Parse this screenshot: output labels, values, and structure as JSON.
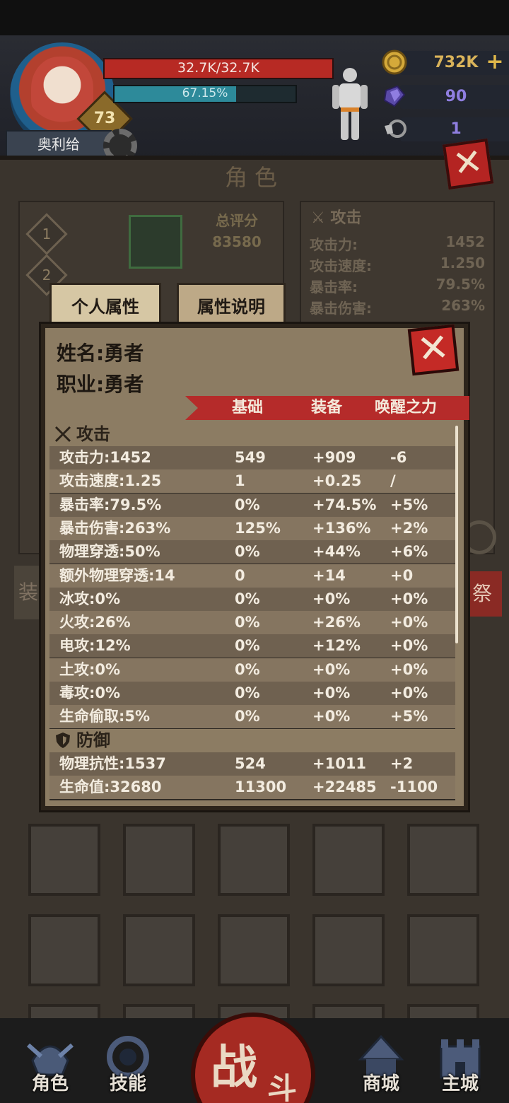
{
  "player": {
    "name": "奥利给",
    "level": "73",
    "hp_text": "32.7K/32.7K",
    "exp_text": "67.15%",
    "exp_percent": 67.15
  },
  "resources": {
    "gold": "732K",
    "gem": "90",
    "ticket": "1",
    "add_symbol": "+"
  },
  "panel": {
    "title": "角色",
    "close_symbol": "✕",
    "slots": [
      "1",
      "2"
    ],
    "score_label": "总评分",
    "score_value": "83580",
    "bg_attack_title": "攻击",
    "bg_stats": [
      {
        "label": "攻击力:",
        "value": "1452"
      },
      {
        "label": "攻击速度:",
        "value": "1.250"
      },
      {
        "label": "暴击率:",
        "value": "79.5%"
      },
      {
        "label": "暴击伤害:",
        "value": "263%"
      }
    ],
    "side_tag_left": "装",
    "side_tag_right": "祭"
  },
  "tabs": {
    "personal": "个人属性",
    "explain": "属性说明"
  },
  "modal": {
    "name_label": "姓名:",
    "name_value": "勇者",
    "class_label": "职业:",
    "class_value": "勇者",
    "close_symbol": "✕",
    "headers": {
      "base": "基础",
      "equip": "装备",
      "awaken": "唤醒之力"
    },
    "sections": {
      "attack": {
        "title": "攻击",
        "rows": [
          {
            "label": "攻击力:1452",
            "base": "549",
            "equip": "+909",
            "awaken": "-6"
          },
          {
            "label": "攻击速度:1.25",
            "base": "1",
            "equip": "+0.25",
            "awaken": "/"
          },
          {
            "label": "暴击率:79.5%",
            "base": "0%",
            "equip": "+74.5%",
            "awaken": "+5%"
          },
          {
            "label": "暴击伤害:263%",
            "base": "125%",
            "equip": "+136%",
            "awaken": "+2%"
          },
          {
            "label": "物理穿透:50%",
            "base": "0%",
            "equip": "+44%",
            "awaken": "+6%"
          },
          {
            "label": "额外物理穿透:14",
            "base": "0",
            "equip": "+14",
            "awaken": "+0"
          },
          {
            "label": "冰攻:0%",
            "base": "0%",
            "equip": "+0%",
            "awaken": "+0%"
          },
          {
            "label": "火攻:26%",
            "base": "0%",
            "equip": "+26%",
            "awaken": "+0%"
          },
          {
            "label": "电攻:12%",
            "base": "0%",
            "equip": "+12%",
            "awaken": "+0%"
          },
          {
            "label": "土攻:0%",
            "base": "0%",
            "equip": "+0%",
            "awaken": "+0%"
          },
          {
            "label": "毒攻:0%",
            "base": "0%",
            "equip": "+0%",
            "awaken": "+0%"
          },
          {
            "label": "生命偷取:5%",
            "base": "0%",
            "equip": "+0%",
            "awaken": "+5%"
          }
        ]
      },
      "defense": {
        "title": "防御",
        "rows": [
          {
            "label": "物理抗性:1537",
            "base": "524",
            "equip": "+1011",
            "awaken": "+2"
          },
          {
            "label": "生命值:32680",
            "base": "11300",
            "equip": "+22485",
            "awaken": "-1100"
          }
        ]
      }
    }
  },
  "nav": {
    "role": "角色",
    "skills": "技能",
    "fight_1": "战",
    "fight_2": "斗",
    "shop": "商城",
    "city": "主城"
  },
  "colors": {
    "accent_red": "#b52b2a",
    "gold": "#d9b35a",
    "parchment": "#8c7c63"
  }
}
